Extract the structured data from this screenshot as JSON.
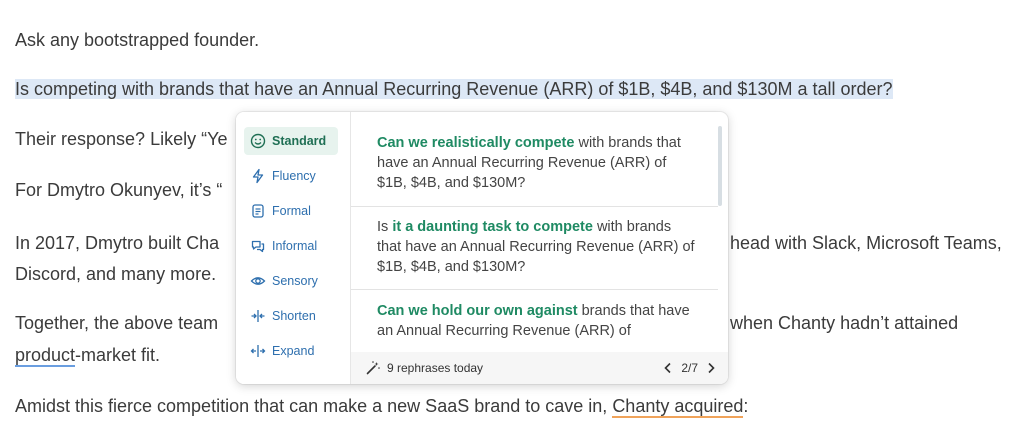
{
  "article": {
    "p1": "Ask any bootstrapped founder.",
    "p2": "Is competing with brands that have an Annual Recurring Revenue (ARR) of $1B, $4B, and $130M a tall order?",
    "p3_before": "Their response? Likely “Ye",
    "p4_before": "For Dmytro Okunyev, it’s “",
    "p5_before": "In 2017, Dmytro built Cha",
    "p5_after": "head with Slack, Microsoft Teams,",
    "p6": "Discord, and many more.",
    "p7_before": "Together, the above team",
    "p7_after": "when Chanty hadn’t attained",
    "p8_link": "product",
    "p8_rest": "-market fit.",
    "p9_before": "Amidst this fierce competition that can make a new SaaS brand to cave in, ",
    "p9_link": "Chanty acquired",
    "p9_after": ":"
  },
  "popup": {
    "modes": [
      {
        "label": "Standard",
        "icon": "smile-icon",
        "active": true
      },
      {
        "label": "Fluency",
        "icon": "bolt-icon",
        "active": false
      },
      {
        "label": "Formal",
        "icon": "document-icon",
        "active": false
      },
      {
        "label": "Informal",
        "icon": "chat-icon",
        "active": false
      },
      {
        "label": "Sensory",
        "icon": "eye-icon",
        "active": false
      },
      {
        "label": "Shorten",
        "icon": "shorten-icon",
        "active": false
      },
      {
        "label": "Expand",
        "icon": "expand-icon",
        "active": false
      }
    ],
    "suggestions": [
      {
        "lead": "",
        "emph": "Can we realistically compete",
        "rest": " with brands that have an Annual Recurring Revenue (ARR) of $1B, $4B, and $130M?"
      },
      {
        "lead": "Is ",
        "emph": "it a daunting task to compete",
        "rest": " with brands that have an Annual Recurring Revenue (ARR) of $1B, $4B, and $130M?"
      },
      {
        "lead": "",
        "emph": "Can we hold our own against",
        "rest": " brands that have an Annual Recurring Revenue (ARR) of"
      }
    ],
    "footer": {
      "count_text": "9 rephrases today",
      "page": "2/7"
    }
  },
  "colors": {
    "accent_green": "#1f8a63",
    "mode_blue": "#2e6fae",
    "highlight": "#dde8f6"
  }
}
